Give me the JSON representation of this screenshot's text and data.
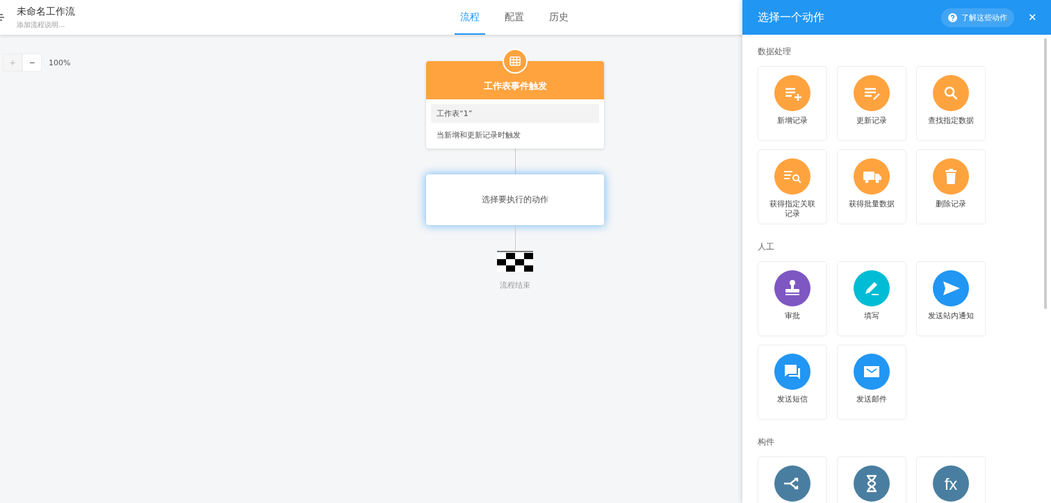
{
  "header": {
    "title": "未命名工作流",
    "description": "添加流程说明..."
  },
  "tabs": [
    {
      "label": "流程",
      "selected": true
    },
    {
      "label": "配置",
      "selected": false
    },
    {
      "label": "历史",
      "selected": false
    }
  ],
  "zoom": {
    "plus": "+",
    "minus": "−",
    "value": "100%"
  },
  "flow": {
    "trigger": {
      "title": "工作表事件触发",
      "sheet": "工作表“1”",
      "condition": "当新增和更新记录时触发"
    },
    "action": {
      "label": "选择要执行的动作"
    },
    "end": {
      "label": "流程结束"
    }
  },
  "panel": {
    "title": "选择一个动作",
    "help": "了解这些动作",
    "close": "✕",
    "sections": [
      {
        "title": "数据处理",
        "items": [
          {
            "kind": "add",
            "color": "#ffa33f",
            "label": "新增记录"
          },
          {
            "kind": "edit",
            "color": "#ffa33f",
            "label": "更新记录"
          },
          {
            "kind": "search",
            "color": "#ffa33f",
            "label": "查找指定数据"
          },
          {
            "kind": "listsearch",
            "color": "#ffa33f",
            "label": "获得指定关联记录"
          },
          {
            "kind": "truck",
            "color": "#ffa33f",
            "label": "获得批量数据"
          },
          {
            "kind": "trash",
            "color": "#ffa33f",
            "label": "删除记录"
          }
        ]
      },
      {
        "title": "人工",
        "items": [
          {
            "kind": "stamp",
            "color": "#7e57c2",
            "label": "审批"
          },
          {
            "kind": "pencil",
            "color": "#00bcd4",
            "label": "填写"
          },
          {
            "kind": "send",
            "color": "#2196f3",
            "label": "发送站内通知"
          },
          {
            "kind": "chat",
            "color": "#2196f3",
            "label": "发送短信"
          },
          {
            "kind": "mail",
            "color": "#2196f3",
            "label": "发送邮件"
          }
        ]
      },
      {
        "title": "构件",
        "items": [
          {
            "kind": "branch",
            "color": "#4a7ea0"
          },
          {
            "kind": "hourglass",
            "color": "#4a7ea0"
          },
          {
            "kind": "glyph",
            "glyph": "fx",
            "color": "#4a7ea0"
          }
        ]
      }
    ]
  }
}
